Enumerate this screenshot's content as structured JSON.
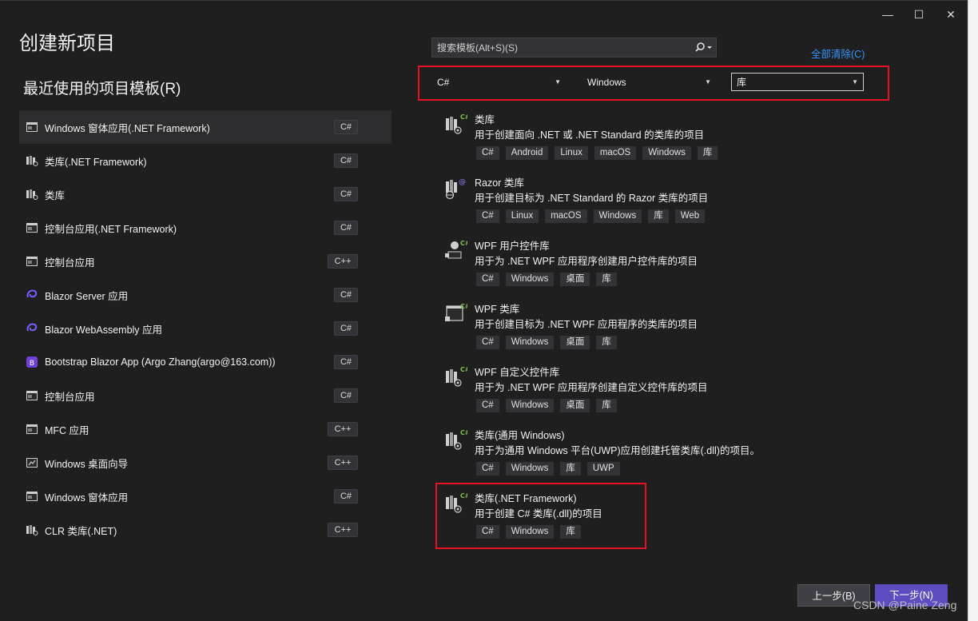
{
  "window": {
    "controls": {
      "minimize": "—",
      "maximize": "☐",
      "close": "✕"
    },
    "page_title": "创建新项目",
    "recent_title": "最近使用的项目模板(R)"
  },
  "recent_templates": [
    {
      "label": "Windows 窗体应用(.NET Framework)",
      "lang": "C#",
      "icon": "winforms-icon",
      "selected": true
    },
    {
      "label": "类库(.NET Framework)",
      "lang": "C#",
      "icon": "class-library-icon"
    },
    {
      "label": "类库",
      "lang": "C#",
      "icon": "class-library-icon"
    },
    {
      "label": "控制台应用(.NET Framework)",
      "lang": "C#",
      "icon": "console-app-icon"
    },
    {
      "label": "控制台应用",
      "lang": "C++",
      "icon": "console-app-icon"
    },
    {
      "label": "Blazor Server 应用",
      "lang": "C#",
      "icon": "blazor-icon"
    },
    {
      "label": "Blazor WebAssembly 应用",
      "lang": "C#",
      "icon": "blazor-icon"
    },
    {
      "label": "Bootstrap Blazor App (Argo Zhang(argo@163.com))",
      "lang": "C#",
      "icon": "bootstrap-blazor-icon"
    },
    {
      "label": "控制台应用",
      "lang": "C#",
      "icon": "console-app-icon"
    },
    {
      "label": "MFC 应用",
      "lang": "C++",
      "icon": "mfc-app-icon"
    },
    {
      "label": "Windows 桌面向导",
      "lang": "C++",
      "icon": "desktop-wizard-icon"
    },
    {
      "label": "Windows 窗体应用",
      "lang": "C#",
      "icon": "winforms-icon"
    },
    {
      "label": "CLR 类库(.NET)",
      "lang": "C++",
      "icon": "clr-library-icon"
    }
  ],
  "search": {
    "placeholder": "搜索模板(Alt+S)(S)",
    "icon": "search-icon"
  },
  "clear_all": "全部清除(C)",
  "filters": {
    "language": "C#",
    "platform": "Windows",
    "project_type": "库"
  },
  "templates": [
    {
      "name": "类库",
      "desc": "用于创建面向 .NET 或 .NET Standard 的类库的项目",
      "tags": [
        "C#",
        "Android",
        "Linux",
        "macOS",
        "Windows",
        "库"
      ],
      "icon": "class-library-icon"
    },
    {
      "name": "Razor 类库",
      "desc": "用于创建目标为 .NET Standard 的 Razor 类库的项目",
      "tags": [
        "C#",
        "Linux",
        "macOS",
        "Windows",
        "库",
        "Web"
      ],
      "icon": "razor-library-icon"
    },
    {
      "name": "WPF 用户控件库",
      "desc": "用于为 .NET WPF 应用程序创建用户控件库的项目",
      "tags": [
        "C#",
        "Windows",
        "桌面",
        "库"
      ],
      "icon": "wpf-user-control-icon"
    },
    {
      "name": "WPF 类库",
      "desc": "用于创建目标为 .NET WPF 应用程序的类库的项目",
      "tags": [
        "C#",
        "Windows",
        "桌面",
        "库"
      ],
      "icon": "wpf-library-icon"
    },
    {
      "name": "WPF 自定义控件库",
      "desc": "用于为 .NET WPF 应用程序创建自定义控件库的项目",
      "tags": [
        "C#",
        "Windows",
        "桌面",
        "库"
      ],
      "icon": "wpf-custom-control-icon"
    },
    {
      "name": "类库(通用 Windows)",
      "desc": "用于为通用 Windows 平台(UWP)应用创建托管类库(.dll)的项目。",
      "tags": [
        "C#",
        "Windows",
        "库",
        "UWP"
      ],
      "icon": "uwp-library-icon"
    },
    {
      "name": "类库(.NET Framework)",
      "desc": "用于创建 C# 类库(.dll)的项目",
      "tags": [
        "C#",
        "Windows",
        "库"
      ],
      "icon": "class-library-icon"
    }
  ],
  "buttons": {
    "back": "上一步(B)",
    "next": "下一步(N)"
  },
  "watermark": "CSDN @Paine Zeng",
  "colors": {
    "background": "#1f1f1f",
    "accent": "#5c4dc1",
    "link": "#3794ff",
    "highlight": "#e81123"
  }
}
